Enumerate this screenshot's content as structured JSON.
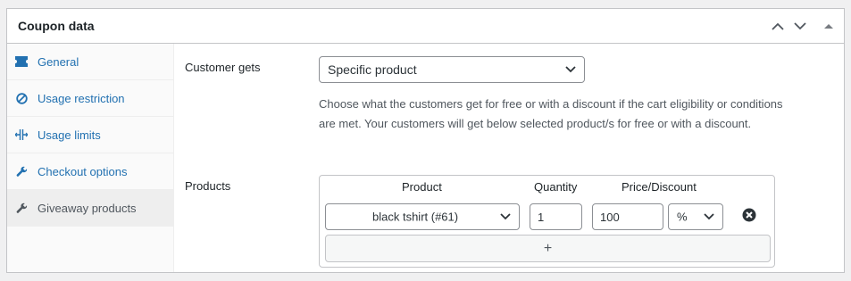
{
  "panel": {
    "title": "Coupon data",
    "header_icons": [
      "chevron-up-icon",
      "chevron-down-icon",
      "collapse-triangle-icon"
    ]
  },
  "tabs": [
    {
      "label": "General",
      "icon": "ticket-icon",
      "active": false
    },
    {
      "label": "Usage restriction",
      "icon": "no-entry-icon",
      "active": false
    },
    {
      "label": "Usage limits",
      "icon": "limits-icon",
      "active": false
    },
    {
      "label": "Checkout options",
      "icon": "wrench-icon",
      "active": false
    },
    {
      "label": "Giveaway products",
      "icon": "wrench-icon",
      "active": true
    }
  ],
  "customer_gets": {
    "label": "Customer gets",
    "selected": "Specific product",
    "description": "Choose what the customers get for free or with a discount if the cart eligibility or conditions are met. Your customers will get below selected product/s for free or with a discount."
  },
  "products": {
    "label": "Products",
    "columns": [
      "Product",
      "Quantity",
      "Price/Discount"
    ],
    "rows": [
      {
        "product": "black tshirt (#61)",
        "quantity": "1",
        "price": "100",
        "discount_type": "%"
      }
    ],
    "add_label": "+"
  },
  "colors": {
    "link": "#2271b1",
    "border": "#c3c4c7",
    "active_tab_bg": "#eeeeee"
  }
}
